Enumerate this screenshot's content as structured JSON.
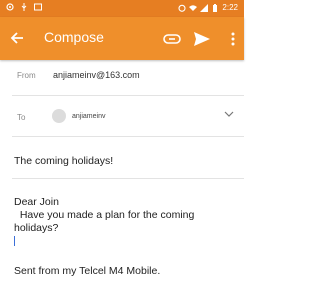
{
  "status_bar": {
    "time": "2:22"
  },
  "app_bar": {
    "title": "Compose",
    "accent": "#ef8f2b",
    "icons": [
      "back-arrow-icon",
      "attach-icon",
      "send-icon",
      "more-vert-icon"
    ]
  },
  "compose": {
    "from_label": "From",
    "from_value": "anjiameinv@163.com",
    "to_label": "To",
    "to_chip": "anjiameinv",
    "subject": "The coming holidays!",
    "body": "Dear Join\n  Have you made a plan for the coming\nholidays?",
    "signature": "Sent from my Telcel M4 Mobile."
  }
}
